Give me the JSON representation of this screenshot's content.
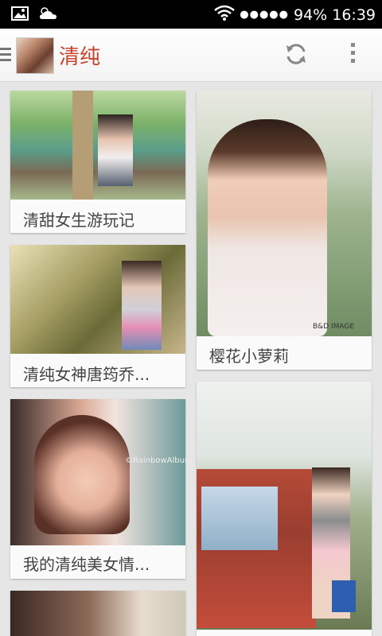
{
  "status_bar": {
    "battery": "94%",
    "time": "16:39",
    "signal": "●●●●●"
  },
  "action_bar": {
    "title": "清纯"
  },
  "cards": [
    {
      "caption": "清甜女生游玩记"
    },
    {
      "caption": "清纯女神唐筠乔..."
    },
    {
      "caption": "我的清纯美女情..."
    },
    {
      "caption": "樱花小萝莉",
      "watermark": "B&D IMAGE"
    },
    {
      "caption": "",
      "watermark": ""
    }
  ],
  "photo_watermarks": {
    "card3": "©RainbowAlbum"
  }
}
